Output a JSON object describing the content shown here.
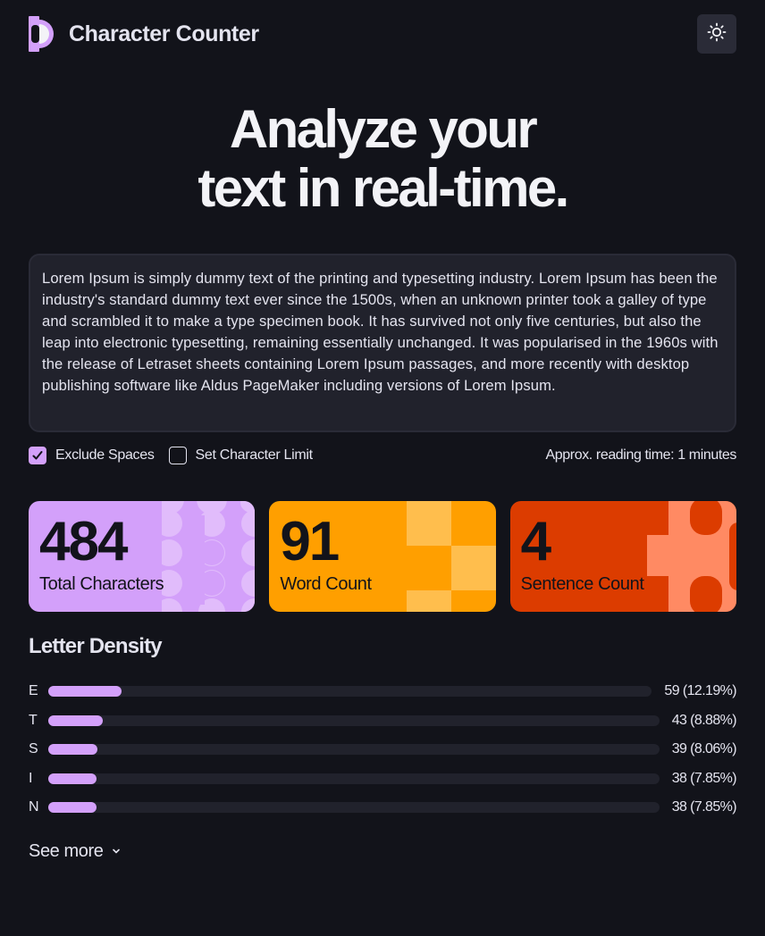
{
  "header": {
    "app_title": "Character Counter",
    "logo_icon": "logo-mark",
    "theme_icon": "sun-icon"
  },
  "hero": {
    "line1": "Analyze your",
    "line2": "text in real-time."
  },
  "textarea": {
    "value": "Lorem Ipsum is simply dummy text of the printing and typesetting industry. Lorem Ipsum has been the industry's standard dummy text ever since the 1500s, when an unknown printer took a galley of type and scrambled it to make a type specimen book. It has survived not only five centuries, but also the leap into electronic typesetting, remaining essentially unchanged. It was popularised in the 1960s with the release of Letraset sheets containing Lorem Ipsum passages, and more recently with desktop publishing software like Aldus PageMaker including versions of Lorem Ipsum."
  },
  "options": {
    "exclude_spaces_label": "Exclude Spaces",
    "exclude_spaces_checked": true,
    "char_limit_label": "Set Character Limit",
    "char_limit_checked": false,
    "reading_time": "Approx. reading time: 1 minutes"
  },
  "stats": [
    {
      "value": "484",
      "label": "Total Characters",
      "color": "#d3a0fa"
    },
    {
      "value": "91",
      "label": "Word Count",
      "color": "#ff9f00"
    },
    {
      "value": "4",
      "label": "Sentence Count",
      "color": "#dc3c00"
    }
  ],
  "density": {
    "title": "Letter Density",
    "rows": [
      {
        "letter": "E",
        "value": "59 (12.19%)",
        "fraction": 0.1219
      },
      {
        "letter": "T",
        "value": "43 (8.88%)",
        "fraction": 0.0888
      },
      {
        "letter": "S",
        "value": "39 (8.06%)",
        "fraction": 0.0806
      },
      {
        "letter": "I",
        "value": "38 (7.85%)",
        "fraction": 0.0785
      },
      {
        "letter": "N",
        "value": "38 (7.85%)",
        "fraction": 0.0785
      }
    ],
    "see_more_label": "See more"
  },
  "colors": {
    "background": "#12131a",
    "accent_purple": "#d3a0fa",
    "accent_orange": "#ff9f00",
    "accent_red": "#dc3c00",
    "surface": "#21222c"
  }
}
